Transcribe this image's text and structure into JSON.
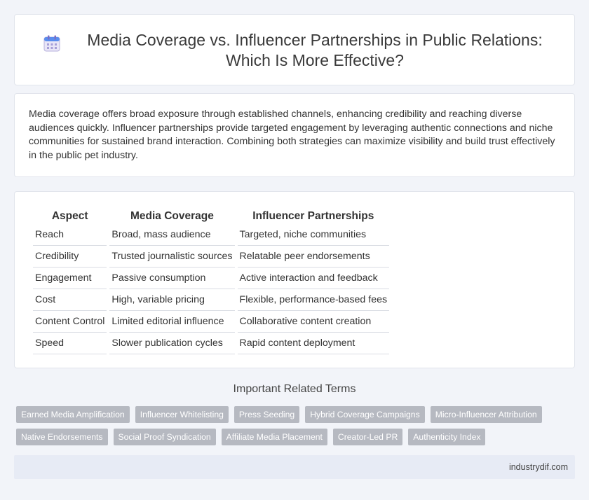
{
  "header": {
    "title": "Media Coverage vs. Influencer Partnerships in Public Relations: Which Is More Effective?",
    "icon": "calendar-icon"
  },
  "intro": "Media coverage offers broad exposure through established channels, enhancing credibility and reaching diverse audiences quickly. Influencer partnerships provide targeted engagement by leveraging authentic connections and niche communities for sustained brand interaction. Combining both strategies can maximize visibility and build trust effectively in the public pet industry.",
  "comparison": {
    "headers": [
      "Aspect",
      "Media Coverage",
      "Influencer Partnerships"
    ],
    "rows": [
      [
        "Reach",
        "Broad, mass audience",
        "Targeted, niche communities"
      ],
      [
        "Credibility",
        "Trusted journalistic sources",
        "Relatable peer endorsements"
      ],
      [
        "Engagement",
        "Passive consumption",
        "Active interaction and feedback"
      ],
      [
        "Cost",
        "High, variable pricing",
        "Flexible, performance-based fees"
      ],
      [
        "Content Control",
        "Limited editorial influence",
        "Collaborative content creation"
      ],
      [
        "Speed",
        "Slower publication cycles",
        "Rapid content deployment"
      ]
    ]
  },
  "related": {
    "title": "Important Related Terms",
    "tags": [
      "Earned Media Amplification",
      "Influencer Whitelisting",
      "Press Seeding",
      "Hybrid Coverage Campaigns",
      "Micro-Influencer Attribution",
      "Native Endorsements",
      "Social Proof Syndication",
      "Affiliate Media Placement",
      "Creator-Led PR",
      "Authenticity Index"
    ]
  },
  "footer": {
    "site": "industrydif.com"
  },
  "colors": {
    "background": "#f2f4f9",
    "tag": "#b6b9c1",
    "footer": "#e7ebf5",
    "icon_accent": "#5a8dee"
  }
}
